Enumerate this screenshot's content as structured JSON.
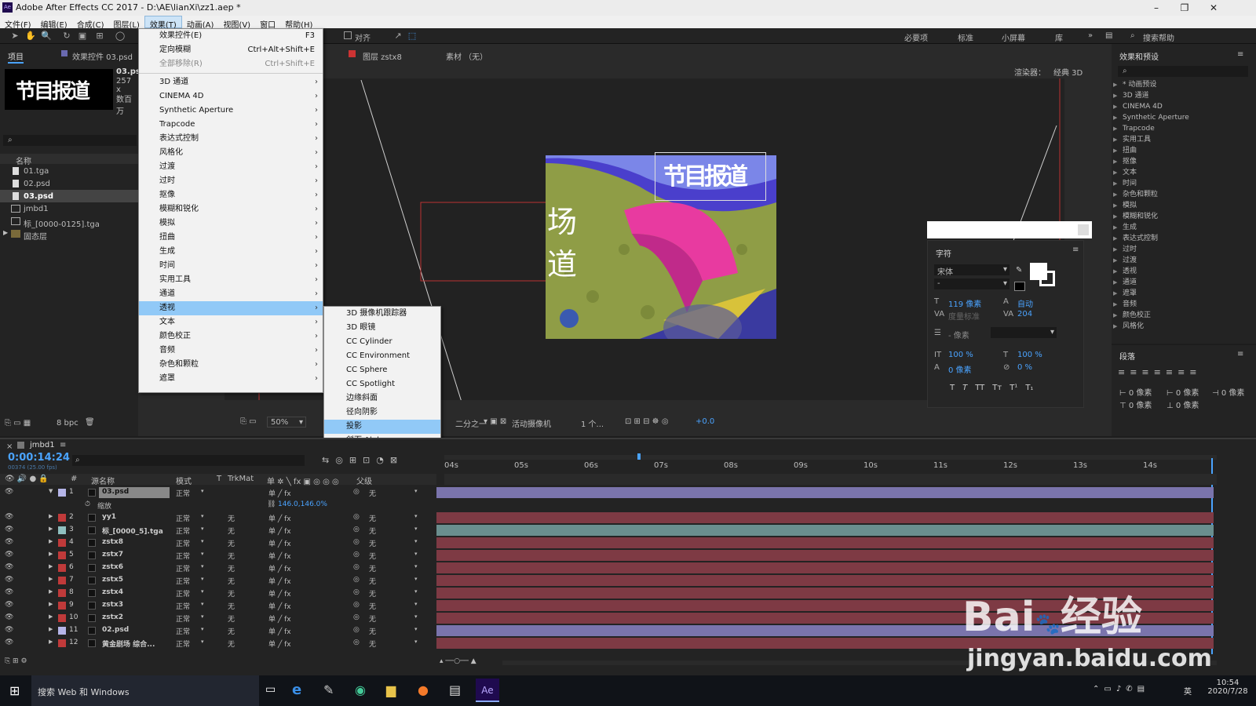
{
  "window": {
    "title": "Adobe After Effects CC 2017 - D:\\AE\\lianXi\\zz1.aep *",
    "app_icon": "Ae"
  },
  "menu": [
    "文件(F)",
    "编辑(E)",
    "合成(C)",
    "图层(L)",
    "效果(T)",
    "动画(A)",
    "视图(V)",
    "窗口",
    "帮助(H)"
  ],
  "toolbar": {
    "snap_label": "对齐",
    "workspaces": [
      "必要项",
      "标准",
      "小屏幕",
      "库"
    ],
    "search_help": "搜索帮助"
  },
  "project": {
    "tab": "项目",
    "effect_controls_tab": "效果控件 03.psd",
    "thumb_text": "节目报道",
    "file_name": "03.psd",
    "file_dims": "257 x",
    "file_extra": "数百万",
    "search_icon": "search-icon",
    "column_name": "名称",
    "items": [
      "01.tga",
      "02.psd",
      "03.psd",
      "jmbd1",
      "标_[0000-0125].tga",
      "固态层"
    ],
    "bpc": "8 bpc"
  },
  "effects_menu": {
    "items": [
      {
        "label": "效果控件(E)",
        "shortcut": "F3"
      },
      {
        "label": "定向模糊",
        "shortcut": "Ctrl+Alt+Shift+E"
      },
      {
        "label": "全部移除(R)",
        "shortcut": "Ctrl+Shift+E"
      }
    ],
    "categories": [
      "3D 通道",
      "CINEMA 4D",
      "Synthetic Aperture",
      "Trapcode",
      "表达式控制",
      "风格化",
      "过渡",
      "过时",
      "抠像",
      "模糊和锐化",
      "模拟",
      "扭曲",
      "生成",
      "时间",
      "实用工具",
      "通道",
      "透视",
      "文本",
      "颜色校正",
      "音频",
      "杂色和颗粒",
      "遮罩"
    ]
  },
  "perspective_submenu": [
    "3D 摄像机跟踪器",
    "3D 眼镜",
    "CC Cylinder",
    "CC Environment",
    "CC Sphere",
    "CC Spotlight",
    "边缘斜面",
    "径向阴影",
    "投影",
    "斜面 Alpha"
  ],
  "viewer": {
    "layer_tab": "图层 zstx8",
    "footage_tab": "素材 （无）",
    "renderer": "渲染器：",
    "renderer_val": "经典 3D",
    "zoom": "50%",
    "resolution": "二分之一",
    "camera": "活动摄像机",
    "views": "1 个...",
    "exposure": "+0.0",
    "comp_title": "节目报道",
    "side_text": "场道"
  },
  "effects_panel": {
    "title": "效果和预设",
    "items": [
      "* 动画预设",
      "3D 通道",
      "CINEMA 4D",
      "Synthetic Aperture",
      "Trapcode",
      "实用工具",
      "扭曲",
      "抠像",
      "文本",
      "时间",
      "杂色和颗粒",
      "模拟",
      "模糊和锐化",
      "生成",
      "表达式控制",
      "过时",
      "过渡",
      "透视",
      "通道",
      "遮罩",
      "音频",
      "颜色校正",
      "风格化"
    ]
  },
  "character": {
    "title": "字符",
    "font": "宋体",
    "style": "-",
    "size": "119 像素",
    "leading": "自动",
    "kerning": "度量标准",
    "tracking": "204",
    "stroke": "- 像素",
    "vscale": "100 %",
    "hscale": "100 %",
    "baseline": "0 像素",
    "tsume": "0 %",
    "styles": [
      "T",
      "T",
      "TT",
      "Tт",
      "T¹",
      "T₁"
    ]
  },
  "paragraph": {
    "title": "段落",
    "indent": [
      "0 像素",
      "0 像素",
      "0 像素",
      "0 像素",
      "0 像素"
    ]
  },
  "timeline": {
    "comp_tab": "jmbd1",
    "timecode": "0:00:14:24",
    "frame_info": "00374 (25.00 fps)",
    "col_layer": "源名称",
    "col_mode": "模式",
    "col_t": "T",
    "col_trkmat": "TrkMat",
    "col_parent": "父级",
    "ruler": [
      "04s",
      "05s",
      "06s",
      "07s",
      "08s",
      "09s",
      "10s",
      "11s",
      "12s",
      "13s",
      "14s"
    ],
    "scale_label": "缩放",
    "scale_val": "146.0,146.0%",
    "layers": [
      {
        "num": "1",
        "name": "03.psd",
        "mode": "正常",
        "trk": "",
        "parent": "无",
        "color": "#b5b5e8"
      },
      {
        "num": "2",
        "name": "yy1",
        "mode": "正常",
        "trk": "无",
        "parent": "无",
        "color": "#c03a3a"
      },
      {
        "num": "3",
        "name": "标_[0000_5].tga",
        "mode": "正常",
        "trk": "无",
        "parent": "无",
        "color": "#8fbfbf"
      },
      {
        "num": "4",
        "name": "zstx8",
        "mode": "正常",
        "trk": "无",
        "parent": "无",
        "color": "#c03a3a"
      },
      {
        "num": "5",
        "name": "zstx7",
        "mode": "正常",
        "trk": "无",
        "parent": "无",
        "color": "#c03a3a"
      },
      {
        "num": "6",
        "name": "zstx6",
        "mode": "正常",
        "trk": "无",
        "parent": "无",
        "color": "#c03a3a"
      },
      {
        "num": "7",
        "name": "zstx5",
        "mode": "正常",
        "trk": "无",
        "parent": "无",
        "color": "#c03a3a"
      },
      {
        "num": "8",
        "name": "zstx4",
        "mode": "正常",
        "trk": "无",
        "parent": "无",
        "color": "#c03a3a"
      },
      {
        "num": "9",
        "name": "zstx3",
        "mode": "正常",
        "trk": "无",
        "parent": "无",
        "color": "#c03a3a"
      },
      {
        "num": "10",
        "name": "zstx2",
        "mode": "正常",
        "trk": "无",
        "parent": "无",
        "color": "#c03a3a"
      },
      {
        "num": "11",
        "name": "02.psd",
        "mode": "正常",
        "trk": "无",
        "parent": "无",
        "color": "#b5b5e8"
      },
      {
        "num": "12",
        "name": "黄金剧场 综合...",
        "mode": "正常",
        "trk": "无",
        "parent": "无",
        "color": "#c03a3a"
      }
    ]
  },
  "watermark": {
    "brand": "Bai",
    "brand2": "经验",
    "url": "jingyan.baidu.com"
  },
  "taskbar": {
    "search": "搜索 Web 和 Windows",
    "time": "10:54",
    "date": "2020/7/28",
    "ime": "英"
  }
}
